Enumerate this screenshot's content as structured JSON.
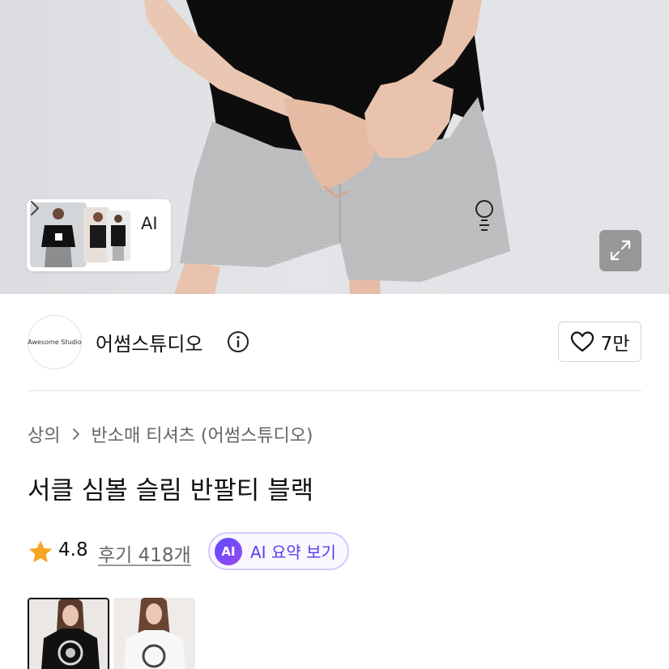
{
  "hero": {
    "thumbnail_ai_label": "AI",
    "expand_icon": "expand-icon"
  },
  "brand": {
    "logo_text": "Awesome Studio",
    "name": "어썸스튜디오",
    "info_icon": "info-icon"
  },
  "like": {
    "icon": "heart-icon",
    "count": "7만"
  },
  "breadcrumb": {
    "category": "상의",
    "subcategory": "반소매 티셔츠 (어썸스튜디오)"
  },
  "product": {
    "title": "서클 심볼 슬림 반팔티 블랙"
  },
  "rating": {
    "score": "4.8",
    "reviews_label": "후기 418개",
    "ai_badge": "AI",
    "ai_summary_label": "AI 요약 보기"
  },
  "colors": {
    "accent": "#5a3cf0",
    "star": "#f5a623",
    "ai_gradient_start": "#5b4bff",
    "ai_gradient_end": "#9a49f0"
  }
}
